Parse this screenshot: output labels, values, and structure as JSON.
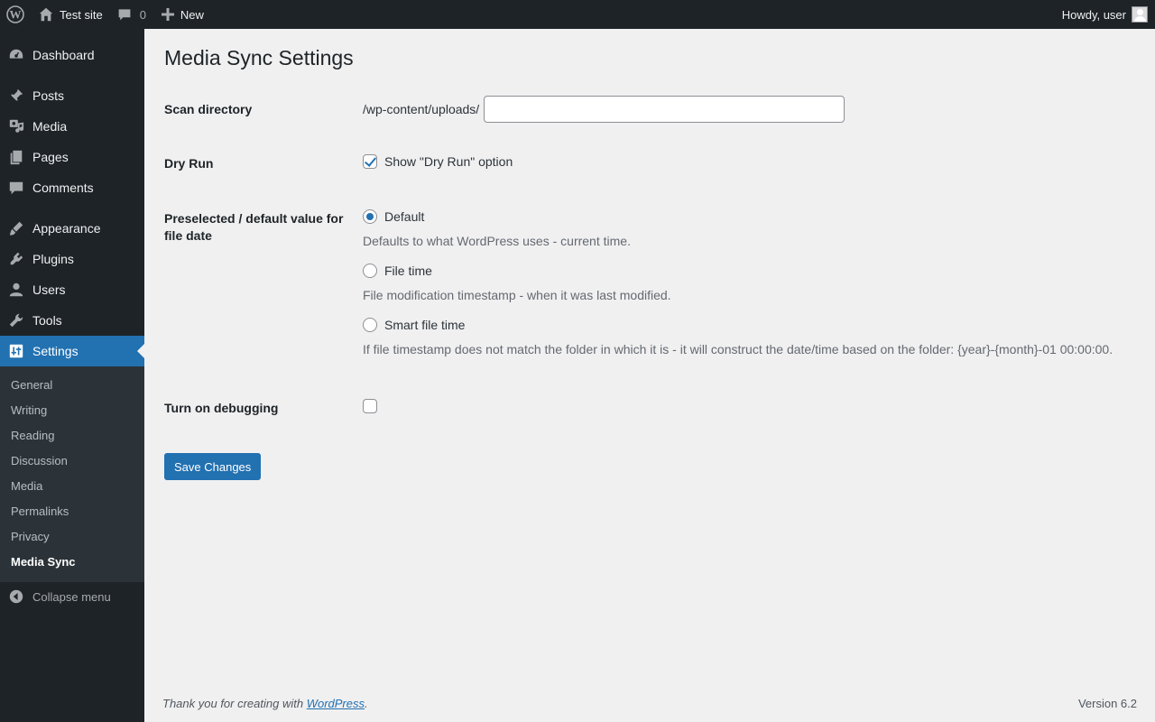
{
  "adminbar": {
    "site_name": "Test site",
    "comments_count": "0",
    "new_label": "New",
    "greeting": "Howdy, user"
  },
  "sidebar": {
    "items": [
      {
        "label": "Dashboard",
        "icon": "dashboard-icon"
      },
      {
        "label": "Posts",
        "icon": "pin-icon"
      },
      {
        "label": "Media",
        "icon": "media-icon"
      },
      {
        "label": "Pages",
        "icon": "pages-icon"
      },
      {
        "label": "Comments",
        "icon": "comment-icon"
      },
      {
        "label": "Appearance",
        "icon": "brush-icon"
      },
      {
        "label": "Plugins",
        "icon": "plugin-icon"
      },
      {
        "label": "Users",
        "icon": "user-icon"
      },
      {
        "label": "Tools",
        "icon": "wrench-icon"
      },
      {
        "label": "Settings",
        "icon": "settings-icon"
      }
    ],
    "submenu": [
      "General",
      "Writing",
      "Reading",
      "Discussion",
      "Media",
      "Permalinks",
      "Privacy",
      "Media Sync"
    ],
    "collapse_label": "Collapse menu"
  },
  "main": {
    "title": "Media Sync Settings",
    "scan_directory": {
      "label": "Scan directory",
      "prefix": "/wp-content/uploads/",
      "value": ""
    },
    "dry_run": {
      "label": "Dry Run",
      "option_label": "Show \"Dry Run\" option",
      "checked": true
    },
    "file_date": {
      "label": "Preselected / default value for file date",
      "options": [
        {
          "label": "Default",
          "description": "Defaults to what WordPress uses - current time.",
          "checked": true
        },
        {
          "label": "File time",
          "description": "File modification timestamp - when it was last modified.",
          "checked": false
        },
        {
          "label": "Smart file time",
          "description": "If file timestamp does not match the folder in which it is - it will construct the date/time based on the folder: {year}-{month}-01 00:00:00.",
          "checked": false
        }
      ]
    },
    "debugging": {
      "label": "Turn on debugging",
      "checked": false
    },
    "save_label": "Save Changes"
  },
  "footer": {
    "thanks_prefix": "Thank you for creating with ",
    "thanks_link": "WordPress",
    "thanks_suffix": ".",
    "version": "Version 6.2"
  },
  "colors": {
    "accent": "#2271b1",
    "sidebar_bg": "#1d2327",
    "submenu_bg": "#2c3338",
    "content_bg": "#f0f0f1"
  }
}
